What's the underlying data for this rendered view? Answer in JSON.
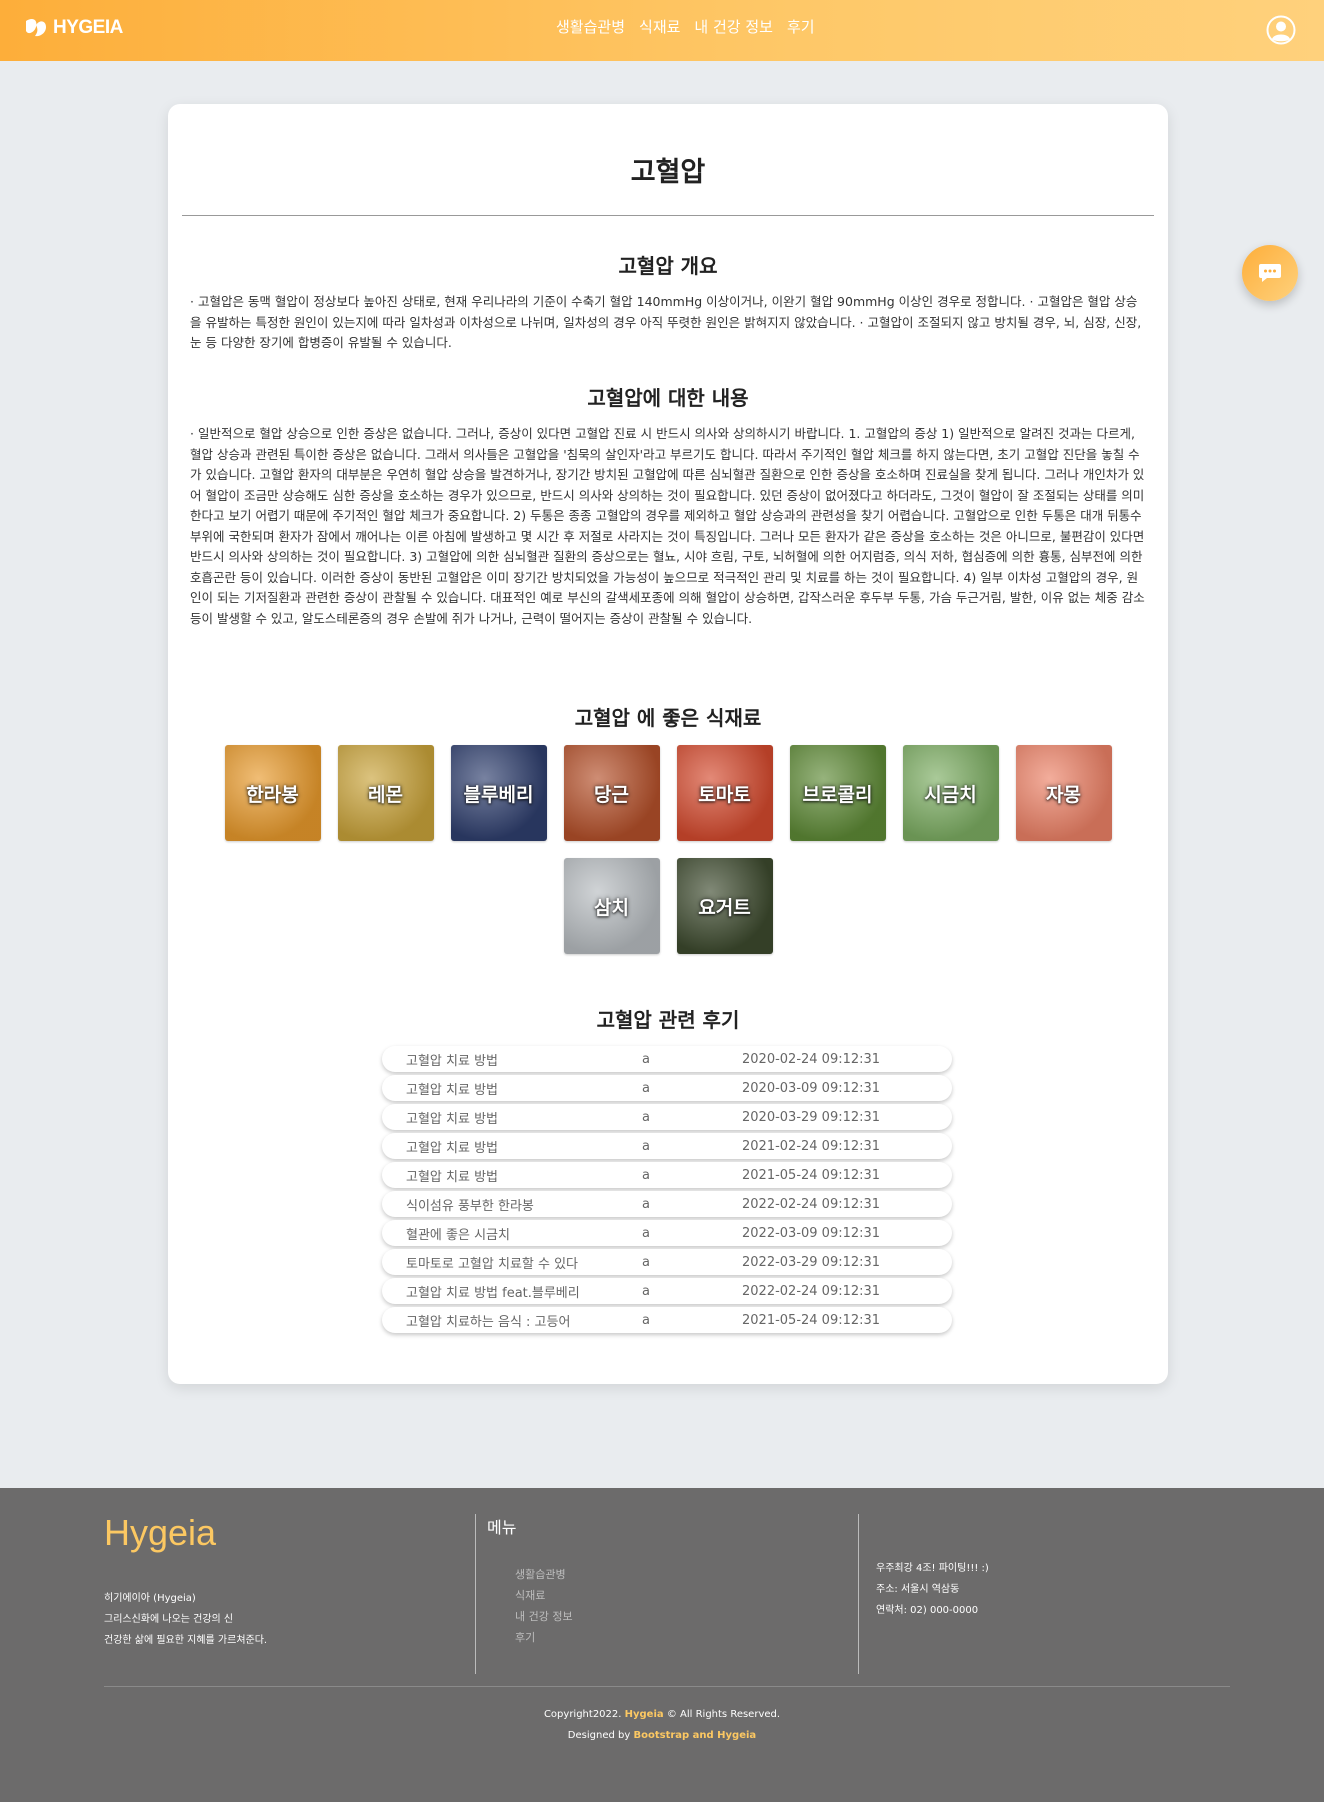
{
  "header": {
    "logo_text": "HYGEIA",
    "nav": [
      "생활습관병",
      "식재료",
      "내 건강 정보",
      "후기"
    ]
  },
  "page": {
    "title": "고혈압",
    "overview_title": "고혈압 개요",
    "overview_text": "· 고혈압은 동맥 혈압이 정상보다 높아진 상태로, 현재 우리나라의 기준이 수축기 혈압 140mmHg 이상이거나, 이완기 혈압 90mmHg 이상인 경우로 정합니다. · 고혈압은 혈압 상승을 유발하는 특정한 원인이 있는지에 따라 일차성과 이차성으로 나뉘며, 일차성의 경우 아직 뚜렷한 원인은 밝혀지지 않았습니다. · 고혈압이 조절되지 않고 방치될 경우, 뇌, 심장, 신장, 눈 등 다양한 장기에 합병증이 유발될 수 있습니다.",
    "content_title": "고혈압에 대한 내용",
    "content_text": "· 일반적으로 혈압 상승으로 인한 증상은 없습니다. 그러나, 증상이 있다면 고혈압 진료 시 반드시 의사와 상의하시기 바랍니다. 1. 고혈압의 증상 1) 일반적으로 알려진 것과는 다르게, 혈압 상승과 관련된 특이한 증상은 없습니다. 그래서 의사들은 고혈압을 '침묵의 살인자'라고 부르기도 합니다. 따라서 주기적인 혈압 체크를 하지 않는다면, 초기 고혈압 진단을 놓칠 수가 있습니다. 고혈압 환자의 대부분은 우연히 혈압 상승을 발견하거나, 장기간 방치된 고혈압에 따른 심뇌혈관 질환으로 인한 증상을 호소하며 진료실을 찾게 됩니다. 그러나 개인차가 있어 혈압이 조금만 상승해도 심한 증상을 호소하는 경우가 있으므로, 반드시 의사와 상의하는 것이 필요합니다. 있던 증상이 없어졌다고 하더라도, 그것이 혈압이 잘 조절되는 상태를 의미한다고 보기 어렵기 때문에 주기적인 혈압 체크가 중요합니다. 2) 두통은 종종 고혈압의 경우를 제외하고 혈압 상승과의 관련성을 찾기 어렵습니다. 고혈압으로 인한 두통은 대개 뒤통수 부위에 국한되며 환자가 잠에서 깨어나는 이른 아침에 발생하고 몇 시간 후 저절로 사라지는 것이 특징입니다. 그러나 모든 환자가 같은 증상을 호소하는 것은 아니므로, 불편감이 있다면 반드시 의사와 상의하는 것이 필요합니다. 3) 고혈압에 의한 심뇌혈관 질환의 증상으로는 혈뇨, 시야 흐림, 구토, 뇌허혈에 의한 어지럼증, 의식 저하, 협심증에 의한 흉통, 심부전에 의한 호흡곤란 등이 있습니다. 이러한 증상이 동반된 고혈압은 이미 장기간 방치되었을 가능성이 높으므로 적극적인 관리 및 치료를 하는 것이 필요합니다. 4) 일부 이차성 고혈압의 경우, 원인이 되는 기저질환과 관련한 증상이 관찰될 수 있습니다. 대표적인 예로 부신의 갈색세포종에 의해 혈압이 상승하면, 갑작스러운 후두부 두통, 가슴 두근거림, 발한, 이유 없는 체중 감소 등이 발생할 수 있고, 알도스테론증의 경우 손발에 쥐가 나거나, 근력이 떨어지는 증상이 관찰될 수 있습니다.",
    "foods_title": "고혈압 에 좋은 식재료",
    "foods": [
      {
        "name": "한라봉",
        "color": "#e89a2c"
      },
      {
        "name": "레몬",
        "color": "#c9a33a"
      },
      {
        "name": "블루베리",
        "color": "#2f3f6e"
      },
      {
        "name": "당근",
        "color": "#b4502a"
      },
      {
        "name": "토마토",
        "color": "#d44a2e"
      },
      {
        "name": "브로콜리",
        "color": "#5e8a36"
      },
      {
        "name": "시금치",
        "color": "#7cad62"
      },
      {
        "name": "자몽",
        "color": "#ec8166"
      },
      {
        "name": "삼치",
        "color": "#b7bcc0"
      },
      {
        "name": "요거트",
        "color": "#3d4a2e"
      }
    ],
    "reviews_title": "고혈압 관련 후기",
    "reviews": [
      {
        "title": "고혈압 치료 방법",
        "author": "a",
        "date": "2020-02-24 09:12:31"
      },
      {
        "title": "고혈압 치료 방법",
        "author": "a",
        "date": "2020-03-09 09:12:31"
      },
      {
        "title": "고혈압 치료 방법",
        "author": "a",
        "date": "2020-03-29 09:12:31"
      },
      {
        "title": "고혈압 치료 방법",
        "author": "a",
        "date": "2021-02-24 09:12:31"
      },
      {
        "title": "고혈압 치료 방법",
        "author": "a",
        "date": "2021-05-24 09:12:31"
      },
      {
        "title": "식이섬유 풍부한 한라봉",
        "author": "a",
        "date": "2022-02-24 09:12:31"
      },
      {
        "title": "혈관에 좋은 시금치",
        "author": "a",
        "date": "2022-03-09 09:12:31"
      },
      {
        "title": "토마토로 고혈압 치료할 수 있다",
        "author": "a",
        "date": "2022-03-29 09:12:31"
      },
      {
        "title": "고혈압 치료 방법 feat.블루베리",
        "author": "a",
        "date": "2022-02-24 09:12:31"
      },
      {
        "title": "고혈압 치료하는 음식 : 고등어",
        "author": "a",
        "date": "2021-05-24 09:12:31"
      }
    ]
  },
  "footer": {
    "brand": "Hygeia",
    "desc": [
      "히기에이아 (Hygeia)",
      "그리스신화에 나오는 건강의 신",
      "건강한 삶에 필요한 지혜를 가르쳐준다."
    ],
    "menu_title": "메뉴",
    "menu": [
      "생활습관병",
      "식재료",
      "내 건강 정보",
      "후기"
    ],
    "contact": [
      "우주최강 4조! 파이팅!!! :)",
      "주소: 서울시 역삼동",
      "연락처: 02) 000-0000"
    ],
    "copyright_prefix": "Copyright2022.",
    "copyright_brand": "Hygeia",
    "copyright_suffix": "© All Rights Reserved.",
    "designed_prefix": "Designed by",
    "designed_by": "Bootstrap and Hygeia"
  },
  "colors": {
    "accent": "#fdae3a",
    "accent_light": "#ffd17c",
    "footer_bg": "#6c6b6b",
    "footer_brand": "#fcc862"
  }
}
